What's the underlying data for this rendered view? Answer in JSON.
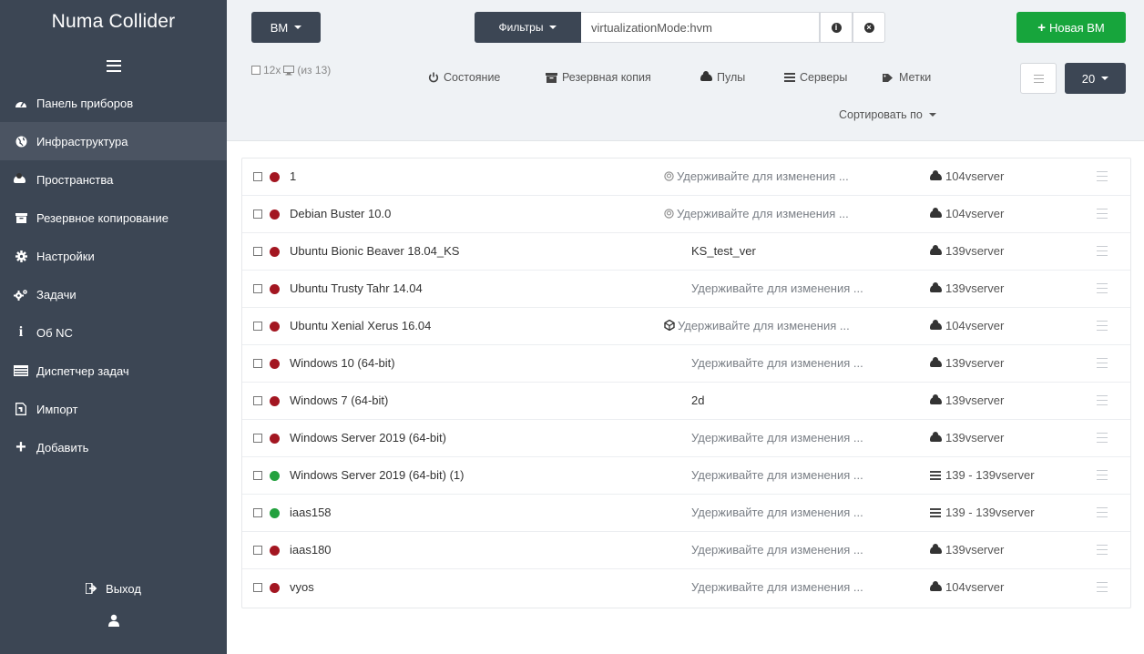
{
  "app": {
    "brand": "Numa Collider"
  },
  "sidebar": {
    "items": [
      {
        "label": "Панель приборов",
        "icon": "dashboard-icon",
        "active": false
      },
      {
        "label": "Инфраструктура",
        "icon": "globe-icon",
        "active": true
      },
      {
        "label": "Пространства",
        "icon": "cloud-icon",
        "active": false
      },
      {
        "label": "Резервное копирование",
        "icon": "archive-icon",
        "active": false
      },
      {
        "label": "Настройки",
        "icon": "gear-icon",
        "active": false
      },
      {
        "label": "Задачи",
        "icon": "gears-icon",
        "active": false
      },
      {
        "label": "Об NC",
        "icon": "info-icon",
        "active": false
      },
      {
        "label": "Диспетчер задач",
        "icon": "task-list-icon",
        "active": false
      },
      {
        "label": "Импорт",
        "icon": "import-file-icon",
        "active": false
      },
      {
        "label": "Добавить",
        "icon": "plus-icon",
        "active": false
      }
    ],
    "logout_label": "Выход"
  },
  "header": {
    "type_button": "ВМ",
    "filters_button": "Фильтры",
    "filter_value": "virtualizationMode:hvm",
    "new_vm_button": "Новая ВМ",
    "selection": {
      "count": "12x",
      "total": "(из 13)"
    },
    "toolbar": {
      "state": "Состояние",
      "backup": "Резервная копия",
      "pools": "Пулы",
      "servers": "Серверы",
      "tags": "Метки"
    },
    "page_size": "20",
    "sort_by": "Сортировать по"
  },
  "colors": {
    "running": "#23a13e",
    "halted": "#a31621",
    "sidebar": "#3c4654",
    "accent_green": "#17a53c"
  },
  "vms": [
    {
      "name": "1",
      "status": "halted",
      "desc": "Удерживайте для изменения ...",
      "desc_icon": "power-icon",
      "host": "104vserver",
      "host_type": "pool"
    },
    {
      "name": "Debian Buster 10.0",
      "status": "halted",
      "desc": "Удерживайте для изменения ...",
      "desc_icon": "power-icon",
      "host": "104vserver",
      "host_type": "pool"
    },
    {
      "name": "Ubuntu Bionic Beaver 18.04_KS",
      "status": "halted",
      "desc": "KS_test_ver",
      "desc_icon": "",
      "host": "139vserver",
      "host_type": "pool"
    },
    {
      "name": "Ubuntu Trusty Tahr 14.04",
      "status": "halted",
      "desc": "Удерживайте для изменения ...",
      "desc_icon": "",
      "host": "139vserver",
      "host_type": "pool"
    },
    {
      "name": "Ubuntu Xenial Xerus 16.04",
      "status": "halted",
      "desc": "Удерживайте для изменения ...",
      "desc_icon": "template-icon",
      "host": "104vserver",
      "host_type": "pool"
    },
    {
      "name": "Windows 10 (64-bit)",
      "status": "halted",
      "desc": "Удерживайте для изменения ...",
      "desc_icon": "",
      "host": "139vserver",
      "host_type": "pool"
    },
    {
      "name": "Windows 7 (64-bit)",
      "status": "halted",
      "desc": "2d",
      "desc_icon": "",
      "host": "139vserver",
      "host_type": "pool"
    },
    {
      "name": "Windows Server 2019 (64-bit)",
      "status": "halted",
      "desc": "Удерживайте для изменения ...",
      "desc_icon": "",
      "host": "139vserver",
      "host_type": "pool"
    },
    {
      "name": "Windows Server 2019 (64-bit) (1)",
      "status": "running",
      "desc": "Удерживайте для изменения ...",
      "desc_icon": "",
      "host": "139 - 139vserver",
      "host_type": "server"
    },
    {
      "name": "iaas158",
      "status": "running",
      "desc": "Удерживайте для изменения ...",
      "desc_icon": "",
      "host": "139 - 139vserver",
      "host_type": "server"
    },
    {
      "name": "iaas180",
      "status": "halted",
      "desc": "Удерживайте для изменения ...",
      "desc_icon": "",
      "host": "139vserver",
      "host_type": "pool"
    },
    {
      "name": "vyos",
      "status": "halted",
      "desc": "Удерживайте для изменения ...",
      "desc_icon": "",
      "host": "104vserver",
      "host_type": "pool"
    }
  ]
}
